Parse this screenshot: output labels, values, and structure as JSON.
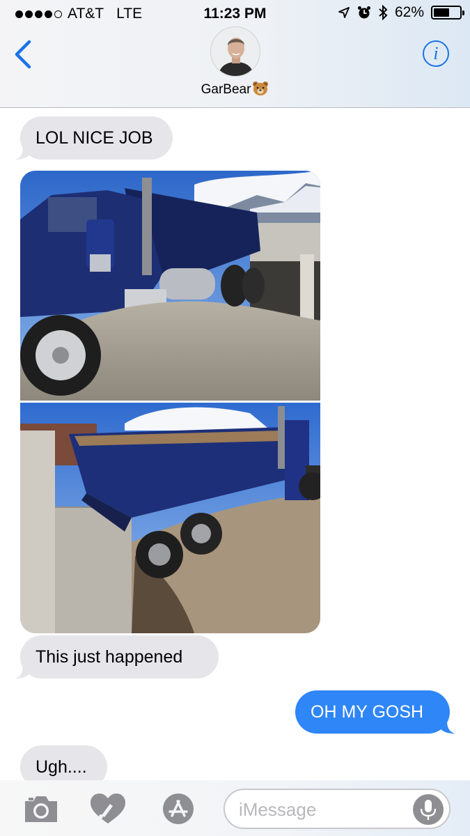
{
  "status_bar": {
    "carrier": "AT&T",
    "network": "LTE",
    "time": "11:23 PM",
    "battery": "62%",
    "battery_level": 0.62
  },
  "header": {
    "contact_name": "GarBear",
    "contact_emoji": "bear-face-icon",
    "back_icon": "chevron-left-icon",
    "info_label": "i"
  },
  "messages": [
    {
      "from": "contact",
      "text": "LOL NICE JOB"
    },
    {
      "from": "contact",
      "type": "photo",
      "description_icon": "dump-truck-photo"
    },
    {
      "from": "contact",
      "type": "photo",
      "description_icon": "dump-truck-photo"
    },
    {
      "from": "contact",
      "text": "This just happened"
    },
    {
      "from": "me",
      "text": "OH MY GOSH"
    },
    {
      "from": "contact",
      "text": "Ugh...."
    }
  ],
  "composer": {
    "placeholder": "iMessage",
    "icons": [
      "camera-icon",
      "digital-touch-icon",
      "app-store-icon",
      "microphone-icon"
    ]
  },
  "colors": {
    "accent": "#1a73e8",
    "outgoing_bubble": "#2f86f6",
    "incoming_bubble": "#e5e5ea"
  }
}
